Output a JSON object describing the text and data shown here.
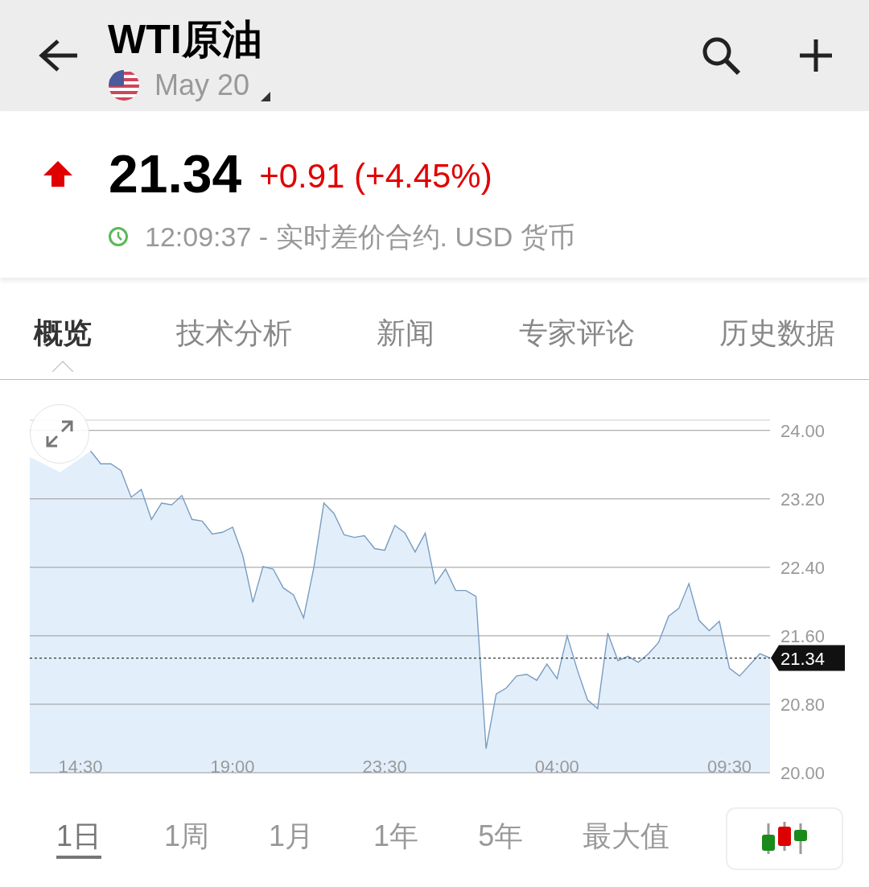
{
  "header": {
    "title": "WTI原油",
    "date": "May 20"
  },
  "quote": {
    "price": "21.34",
    "change": "+0.91 (+4.45%)",
    "rising": true,
    "time": "12:09:37 - 实时差价合约. USD 货币"
  },
  "tabs": [
    {
      "label": "概览",
      "selected": true
    },
    {
      "label": "技术分析",
      "selected": false
    },
    {
      "label": "新闻",
      "selected": false
    },
    {
      "label": "专家评论",
      "selected": false
    },
    {
      "label": "历史数据",
      "selected": false
    }
  ],
  "chart": {
    "chart_data": {
      "type": "area",
      "grid": true,
      "ylim": [
        20,
        24.12
      ],
      "categories": [
        null,
        null,
        null,
        null,
        null,
        "14:30",
        null,
        null,
        null,
        null,
        null,
        null,
        null,
        null,
        null,
        null,
        null,
        null,
        null,
        null,
        "19:00",
        null,
        null,
        null,
        null,
        null,
        null,
        null,
        null,
        null,
        null,
        null,
        null,
        null,
        null,
        "23:30",
        null,
        null,
        null,
        null,
        null,
        null,
        null,
        null,
        null,
        null,
        null,
        null,
        null,
        null,
        null,
        null,
        "04:00",
        null,
        null,
        null,
        null,
        null,
        null,
        null,
        null,
        null,
        null,
        null,
        null,
        null,
        null,
        null,
        null,
        "09:30",
        null,
        null,
        null,
        null
      ],
      "yticks": [
        {
          "value": 20,
          "label": "20.00"
        },
        {
          "value": 20.8,
          "label": "20.80"
        },
        {
          "value": 21.6,
          "label": "21.60"
        },
        {
          "value": 22.4,
          "label": "22.40"
        },
        {
          "value": 23.2,
          "label": "23.20"
        },
        {
          "value": 24,
          "label": "24.00"
        }
      ],
      "series": [
        {
          "color": "#7a9cc0",
          "values": [
            23.69,
            null,
            null,
            23.51,
            null,
            null,
            23.76,
            23.61,
            23.61,
            23.53,
            23.22,
            23.31,
            22.96,
            23.15,
            23.13,
            23.24,
            22.96,
            22.94,
            22.79,
            22.81,
            22.87,
            22.54,
            21.99,
            22.41,
            22.38,
            22.16,
            22.08,
            21.81,
            22.39,
            23.15,
            23.03,
            22.78,
            22.75,
            22.77,
            22.62,
            22.6,
            22.89,
            22.8,
            22.58,
            22.8,
            22.21,
            22.38,
            22.13,
            22.13,
            22.06,
            20.28,
            20.92,
            20.99,
            21.13,
            21.15,
            21.08,
            21.27,
            21.1,
            21.6,
            21.2,
            20.85,
            20.75,
            21.63,
            21.31,
            21.36,
            21.29,
            21.39,
            21.52,
            21.83,
            21.92,
            22.21,
            21.78,
            21.66,
            21.77,
            21.22,
            21.13,
            21.26,
            21.39,
            21.34
          ]
        }
      ],
      "ref_lines": [
        {
          "axis": "y",
          "value": 21.34,
          "label": "21.34",
          "color": "#333333"
        }
      ]
    }
  },
  "ranges": [
    {
      "label": "1日",
      "selected": true
    },
    {
      "label": "1周",
      "selected": false
    },
    {
      "label": "1月",
      "selected": false
    },
    {
      "label": "1年",
      "selected": false
    },
    {
      "label": "5年",
      "selected": false
    },
    {
      "label": "最大值",
      "selected": false
    }
  ]
}
